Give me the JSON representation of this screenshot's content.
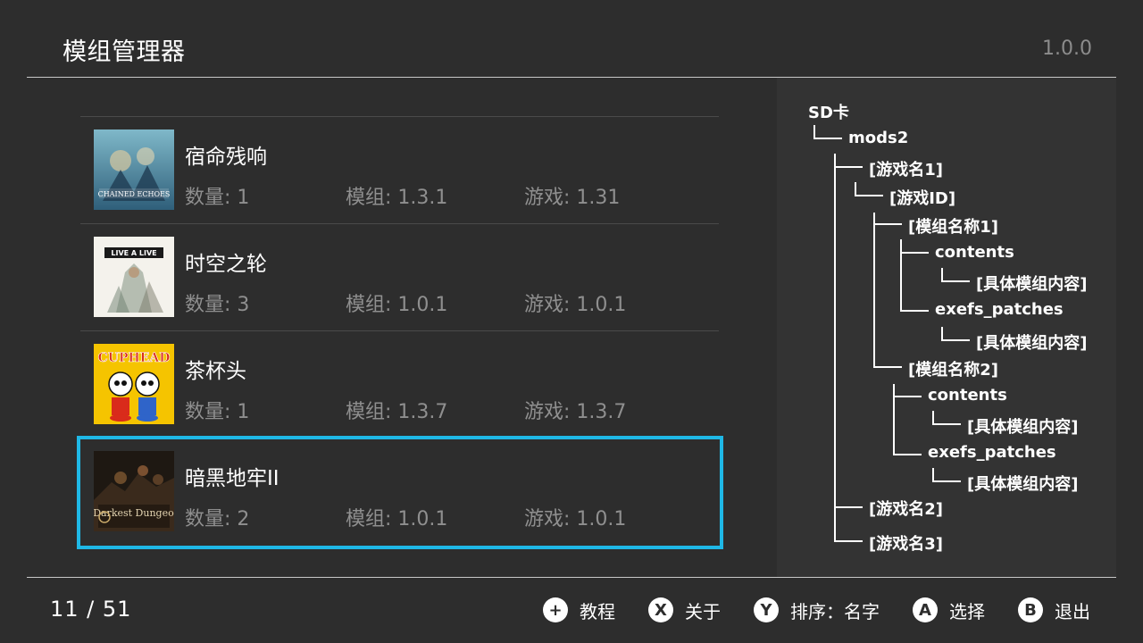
{
  "header": {
    "title": "模组管理器",
    "version": "1.0.0"
  },
  "games": [
    {
      "name": "宿命残响",
      "count": "数量: 1",
      "mod": "模组: 1.3.1",
      "game": "游戏: 1.31",
      "cover_text": "CHAINED ECHOES"
    },
    {
      "name": "时空之轮",
      "count": "数量: 3",
      "mod": "模组: 1.0.1",
      "game": "游戏: 1.0.1",
      "cover_text": "LIVE A LIVE"
    },
    {
      "name": "茶杯头",
      "count": "数量: 1",
      "mod": "模组: 1.3.7",
      "game": "游戏: 1.3.7",
      "cover_text": "CUPHEAD"
    },
    {
      "name": "暗黑地牢II",
      "count": "数量: 2",
      "mod": "模组: 1.0.1",
      "game": "游戏: 1.0.1",
      "cover_text": "Darkest Dungeon"
    }
  ],
  "selected_index": 3,
  "tree": {
    "root": "SD卡",
    "mods": "mods2",
    "game1": "[游戏名1]",
    "gameid": "[游戏ID]",
    "mod1": "[模组名称1]",
    "contents1": "contents",
    "detail1": "[具体模组内容]",
    "exefs1": "exefs_patches",
    "detail2": "[具体模组内容]",
    "mod2": "[模组名称2]",
    "contents2": "contents",
    "detail3": "[具体模组内容]",
    "exefs2": "exefs_patches",
    "detail4": "[具体模组内容]",
    "game2": "[游戏名2]",
    "game3": "[游戏名3]"
  },
  "footer": {
    "page_counter": "11 / 51",
    "hints": [
      {
        "button": "+",
        "icon": "plus-button-icon",
        "label": "教程"
      },
      {
        "button": "X",
        "icon": "x-button-icon",
        "label": "关于"
      },
      {
        "button": "Y",
        "icon": "y-button-icon",
        "label": "排序：名字"
      },
      {
        "button": "A",
        "icon": "a-button-icon",
        "label": "选择"
      },
      {
        "button": "B",
        "icon": "b-button-icon",
        "label": "退出"
      }
    ]
  },
  "colors": {
    "background": "#2d2d2d",
    "panel": "#333333",
    "accent": "#1fb8e6",
    "muted_text": "#8f8f8f"
  }
}
